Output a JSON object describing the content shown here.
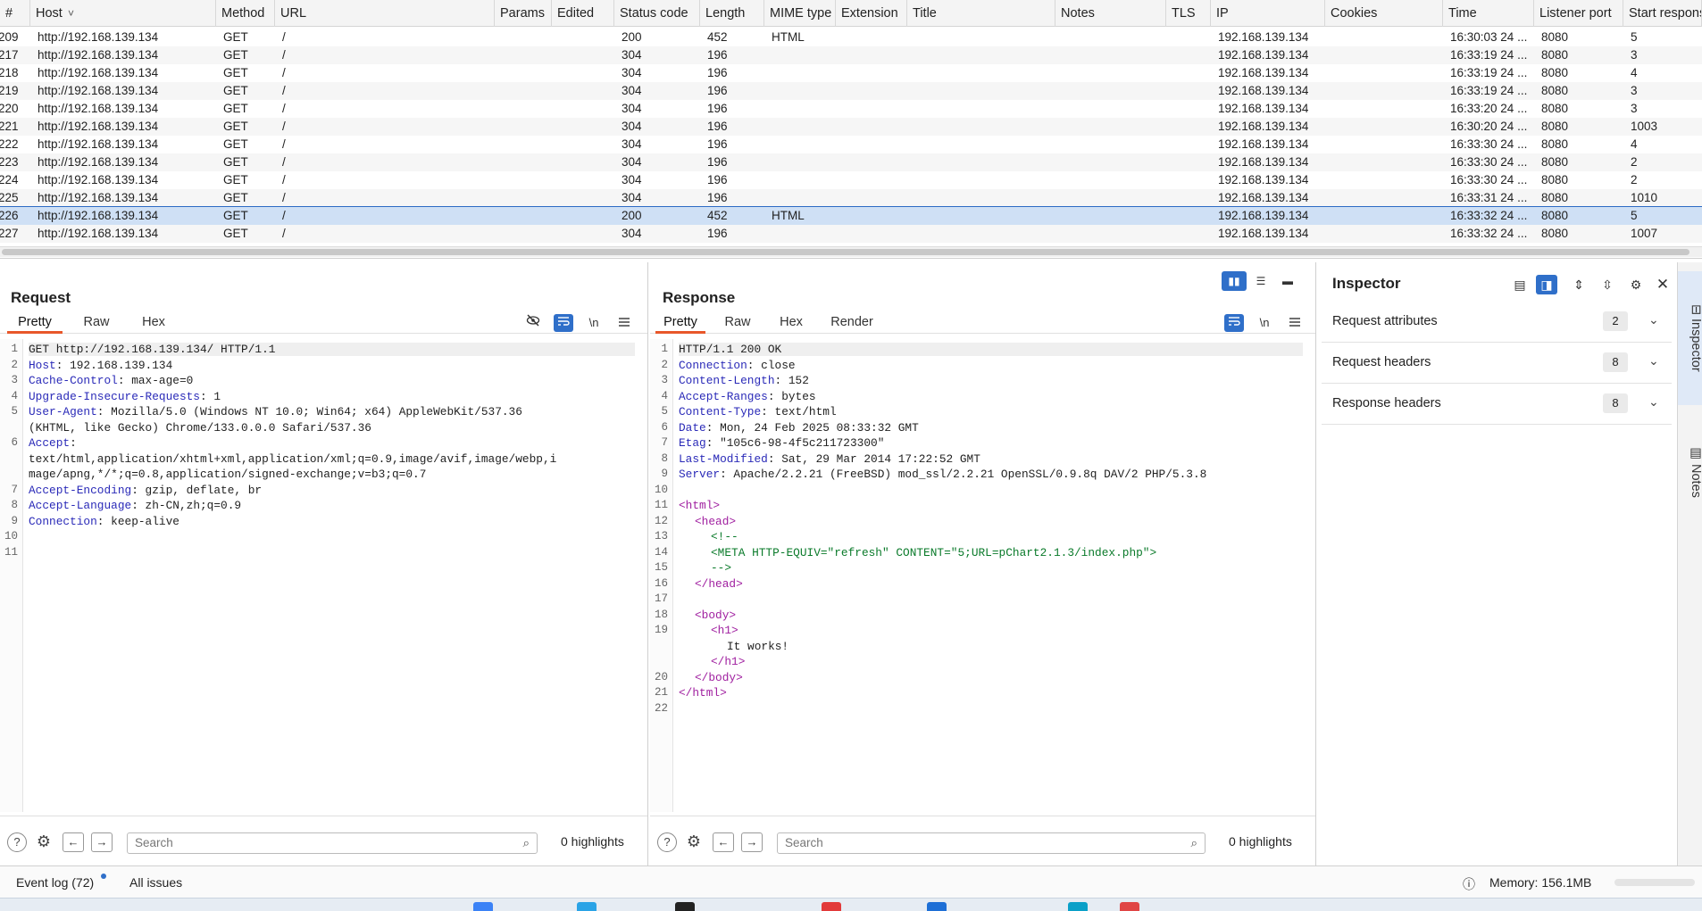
{
  "history": {
    "columns": [
      "#",
      "Host",
      "Method",
      "URL",
      "Params",
      "Edited",
      "Status code",
      "Length",
      "MIME type",
      "Extension",
      "Title",
      "Notes",
      "TLS",
      "IP",
      "Cookies",
      "Time",
      "Listener port",
      "Start respons"
    ],
    "sort_indicator": "˅",
    "rows": [
      [
        "209",
        "http://192.168.139.134",
        "GET",
        "/",
        "",
        "",
        "200",
        "452",
        "HTML",
        "",
        "",
        "",
        "",
        "192.168.139.134",
        "",
        "16:30:03 24 ...",
        "8080",
        "5"
      ],
      [
        "217",
        "http://192.168.139.134",
        "GET",
        "/",
        "",
        "",
        "304",
        "196",
        "",
        "",
        "",
        "",
        "",
        "192.168.139.134",
        "",
        "16:33:19 24 ...",
        "8080",
        "3"
      ],
      [
        "218",
        "http://192.168.139.134",
        "GET",
        "/",
        "",
        "",
        "304",
        "196",
        "",
        "",
        "",
        "",
        "",
        "192.168.139.134",
        "",
        "16:33:19 24 ...",
        "8080",
        "4"
      ],
      [
        "219",
        "http://192.168.139.134",
        "GET",
        "/",
        "",
        "",
        "304",
        "196",
        "",
        "",
        "",
        "",
        "",
        "192.168.139.134",
        "",
        "16:33:19 24 ...",
        "8080",
        "3"
      ],
      [
        "220",
        "http://192.168.139.134",
        "GET",
        "/",
        "",
        "",
        "304",
        "196",
        "",
        "",
        "",
        "",
        "",
        "192.168.139.134",
        "",
        "16:33:20 24 ...",
        "8080",
        "3"
      ],
      [
        "221",
        "http://192.168.139.134",
        "GET",
        "/",
        "",
        "",
        "304",
        "196",
        "",
        "",
        "",
        "",
        "",
        "192.168.139.134",
        "",
        "16:30:20 24 ...",
        "8080",
        "1003"
      ],
      [
        "222",
        "http://192.168.139.134",
        "GET",
        "/",
        "",
        "",
        "304",
        "196",
        "",
        "",
        "",
        "",
        "",
        "192.168.139.134",
        "",
        "16:33:30 24 ...",
        "8080",
        "4"
      ],
      [
        "223",
        "http://192.168.139.134",
        "GET",
        "/",
        "",
        "",
        "304",
        "196",
        "",
        "",
        "",
        "",
        "",
        "192.168.139.134",
        "",
        "16:33:30 24 ...",
        "8080",
        "2"
      ],
      [
        "224",
        "http://192.168.139.134",
        "GET",
        "/",
        "",
        "",
        "304",
        "196",
        "",
        "",
        "",
        "",
        "",
        "192.168.139.134",
        "",
        "16:33:30 24 ...",
        "8080",
        "2"
      ],
      [
        "225",
        "http://192.168.139.134",
        "GET",
        "/",
        "",
        "",
        "304",
        "196",
        "",
        "",
        "",
        "",
        "",
        "192.168.139.134",
        "",
        "16:33:31 24 ...",
        "8080",
        "1010"
      ],
      [
        "226",
        "http://192.168.139.134",
        "GET",
        "/",
        "",
        "",
        "200",
        "452",
        "HTML",
        "",
        "",
        "",
        "",
        "192.168.139.134",
        "",
        "16:33:32 24 ...",
        "8080",
        "5"
      ],
      [
        "227",
        "http://192.168.139.134",
        "GET",
        "/",
        "",
        "",
        "304",
        "196",
        "",
        "",
        "",
        "",
        "",
        "192.168.139.134",
        "",
        "16:33:32 24 ...",
        "8080",
        "1007"
      ]
    ],
    "selected_index": 10
  },
  "request": {
    "title": "Request",
    "tabs": [
      "Pretty",
      "Raw",
      "Hex"
    ],
    "tools": [
      "eye-off-icon",
      "wrap-icon",
      "\\n",
      "menu-icon"
    ],
    "lines": [
      {
        "n": "1",
        "key": "",
        "val": "GET http://192.168.139.134/ HTTP/1.1",
        "hl": true
      },
      {
        "n": "2",
        "key": "Host",
        "val": ": 192.168.139.134"
      },
      {
        "n": "3",
        "key": "Cache-Control",
        "val": ": max-age=0"
      },
      {
        "n": "4",
        "key": "Upgrade-Insecure-Requests",
        "val": ": 1"
      },
      {
        "n": "5",
        "key": "User-Agent",
        "val": ": Mozilla/5.0 (Windows NT 10.0; Win64; x64) AppleWebKit/537.36"
      },
      {
        "n": "",
        "key": "",
        "val": "(KHTML, like Gecko) Chrome/133.0.0.0 Safari/537.36"
      },
      {
        "n": "6",
        "key": "Accept",
        "val": ":"
      },
      {
        "n": "",
        "key": "",
        "val": "text/html,application/xhtml+xml,application/xml;q=0.9,image/avif,image/webp,i"
      },
      {
        "n": "",
        "key": "",
        "val": "mage/apng,*/*;q=0.8,application/signed-exchange;v=b3;q=0.7"
      },
      {
        "n": "7",
        "key": "Accept-Encoding",
        "val": ": gzip, deflate, br"
      },
      {
        "n": "8",
        "key": "Accept-Language",
        "val": ": zh-CN,zh;q=0.9"
      },
      {
        "n": "9",
        "key": "Connection",
        "val": ": keep-alive"
      },
      {
        "n": "10",
        "key": "",
        "val": ""
      },
      {
        "n": "11",
        "key": "",
        "val": ""
      }
    ],
    "search_placeholder": "Search",
    "highlights": "0 highlights"
  },
  "response": {
    "title": "Response",
    "tabs": [
      "Pretty",
      "Raw",
      "Hex",
      "Render"
    ],
    "tools": [
      "wrap-icon",
      "\\n",
      "menu-icon"
    ],
    "lines": [
      {
        "n": "1",
        "key": "",
        "val": "HTTP/1.1 200 OK",
        "hl": true
      },
      {
        "n": "2",
        "key": "Connection",
        "val": ": close"
      },
      {
        "n": "3",
        "key": "Content-Length",
        "val": ": 152"
      },
      {
        "n": "4",
        "key": "Accept-Ranges",
        "val": ": bytes"
      },
      {
        "n": "5",
        "key": "Content-Type",
        "val": ": text/html"
      },
      {
        "n": "6",
        "key": "Date",
        "val": ": Mon, 24 Feb 2025 08:33:32 GMT"
      },
      {
        "n": "7",
        "key": "Etag",
        "val": ": \"105c6-98-4f5c211723300\""
      },
      {
        "n": "8",
        "key": "Last-Modified",
        "val": ": Sat, 29 Mar 2014 17:22:52 GMT"
      },
      {
        "n": "9",
        "key": "Server",
        "val": ": Apache/2.2.21 (FreeBSD) mod_ssl/2.2.21 OpenSSL/0.9.8q DAV/2 PHP/5.3.8"
      },
      {
        "n": "10",
        "key": "",
        "val": ""
      },
      {
        "n": "11",
        "tag": "<html>",
        "indent": 0
      },
      {
        "n": "12",
        "tag": "<head>",
        "indent": 1
      },
      {
        "n": "13",
        "attr": "<!--",
        "indent": 2
      },
      {
        "n": "14",
        "attr": "<META HTTP-EQUIV=\"refresh\" CONTENT=\"5;URL=pChart2.1.3/index.php\">",
        "indent": 2
      },
      {
        "n": "15",
        "attr": "-->",
        "indent": 2
      },
      {
        "n": "16",
        "tag": "</head>",
        "indent": 1
      },
      {
        "n": "17",
        "key": "",
        "val": ""
      },
      {
        "n": "18",
        "tag": "<body>",
        "indent": 1
      },
      {
        "n": "19",
        "tag": "<h1>",
        "indent": 2
      },
      {
        "n": "",
        "val": "It works!",
        "indent": 3
      },
      {
        "n": "",
        "tag": "</h1>",
        "indent": 2
      },
      {
        "n": "20",
        "tag": "</body>",
        "indent": 1
      },
      {
        "n": "21",
        "tag": "</html>",
        "indent": 0
      },
      {
        "n": "22",
        "key": "",
        "val": ""
      }
    ],
    "search_placeholder": "Search",
    "highlights": "0 highlights"
  },
  "inspector": {
    "title": "Inspector",
    "sections": [
      {
        "label": "Request attributes",
        "count": "2"
      },
      {
        "label": "Request headers",
        "count": "8"
      },
      {
        "label": "Response headers",
        "count": "8"
      }
    ]
  },
  "side_tabs": [
    "Inspector",
    "Notes"
  ],
  "status": {
    "event_log": "Event log (72)",
    "all_issues": "All issues",
    "memory": "Memory: 156.1MB"
  },
  "colors": {
    "accent": "#2f6fc9",
    "tab_underline": "#e8572a",
    "header_key": "#2a2ab8",
    "html_tag": "#a020a0",
    "html_attr": "#0a7a2a"
  }
}
